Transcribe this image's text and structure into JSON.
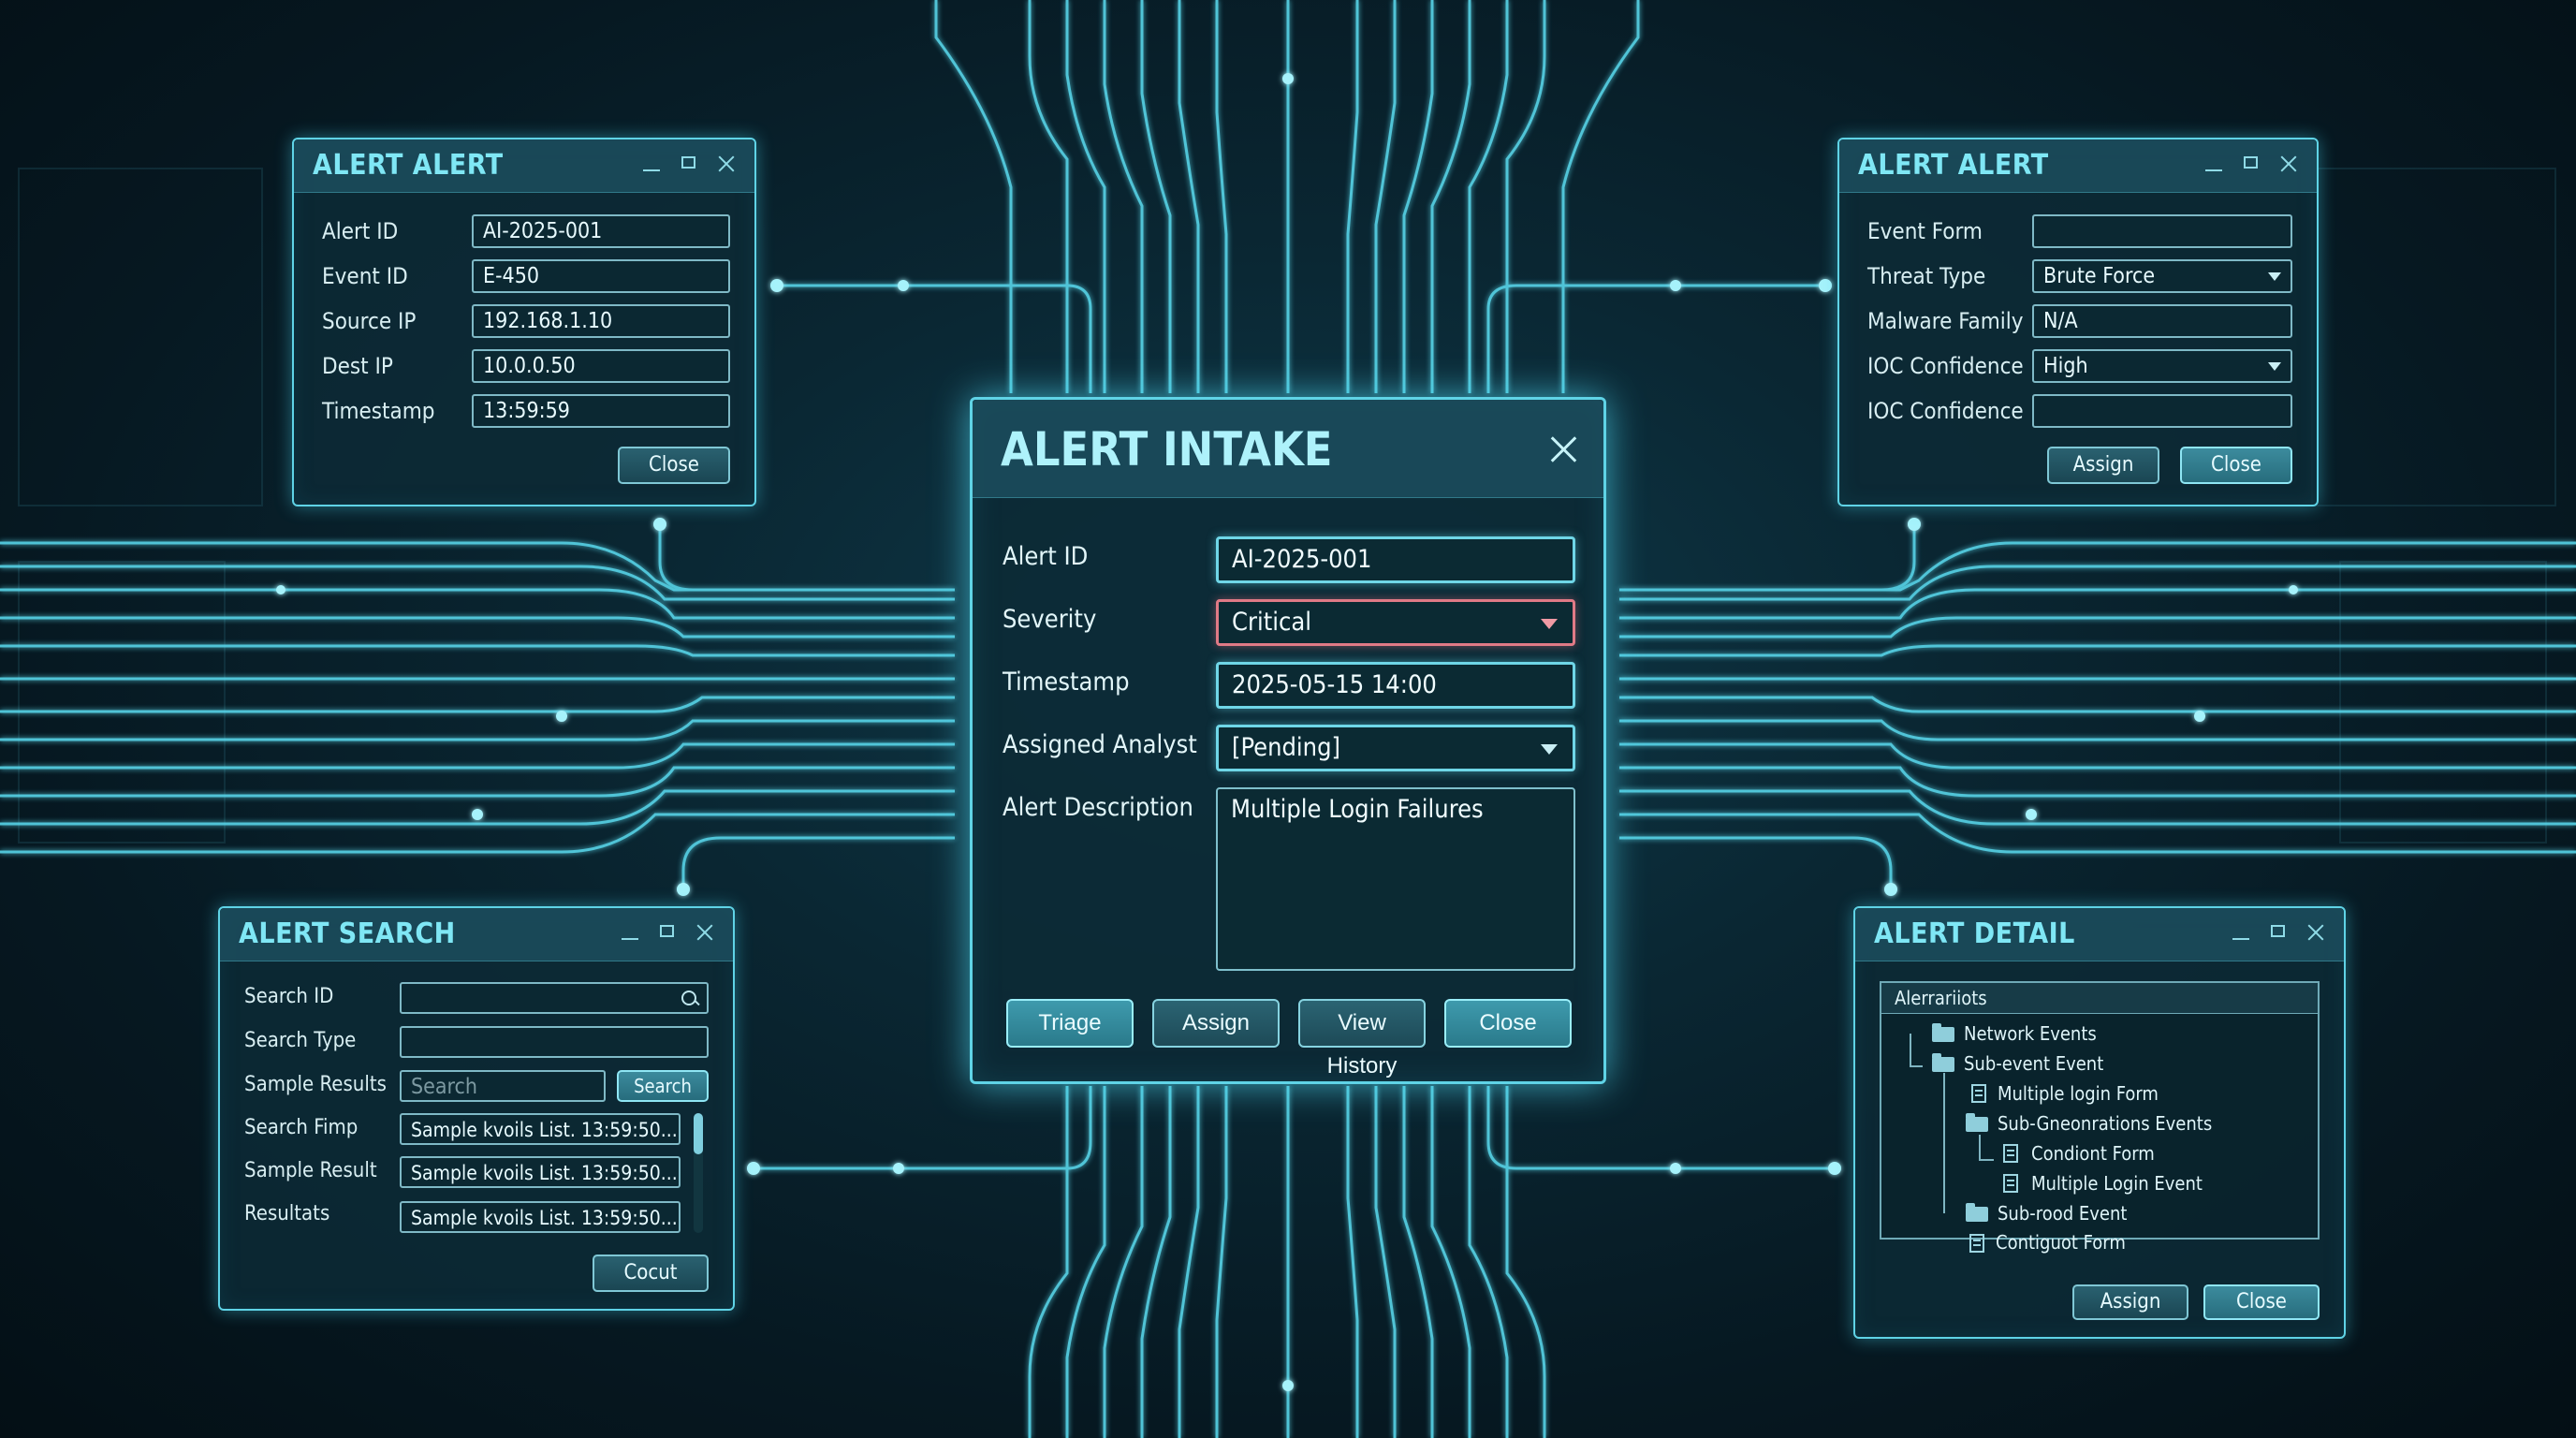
{
  "colors": {
    "accent": "#5fd3e6",
    "alert_red": "#e07a86",
    "background": "#061821"
  },
  "alert_alert_left": {
    "title": "ALERT ALERT",
    "fields": [
      {
        "label": "Alert ID",
        "value": "AI-2025-001"
      },
      {
        "label": "Event ID",
        "value": "E-450"
      },
      {
        "label": "Source IP",
        "value": "192.168.1.10"
      },
      {
        "label": "Dest IP",
        "value": "10.0.0.50"
      },
      {
        "label": "Timestamp",
        "value": "13:59:59"
      }
    ],
    "close_label": "Close"
  },
  "alert_alert_right": {
    "title": "ALERT ALERT",
    "fields": [
      {
        "label": "Event Form",
        "value": ""
      },
      {
        "label": "Threat Type",
        "value": "Brute Force"
      },
      {
        "label": "Malware Family",
        "value": "N/A"
      },
      {
        "label": "IOC Confidence",
        "value": "High"
      },
      {
        "label": "IOC Confidence",
        "value": ""
      }
    ],
    "assign_label": "Assign",
    "close_label": "Close"
  },
  "alert_intake": {
    "title": "ALERT INTAKE",
    "fields": [
      {
        "label": "Alert ID",
        "value": "AI-2025-001"
      },
      {
        "label": "Severity",
        "value": "Critical"
      },
      {
        "label": "Timestamp",
        "value": "2025-05-15 14:00"
      },
      {
        "label": "Assigned Analyst",
        "value": "[Pending]"
      },
      {
        "label": "Alert Description",
        "value": "Multiple Login Failures"
      }
    ],
    "buttons": {
      "triage": "Triage",
      "assign": "Assign",
      "view_history": "View History",
      "close": "Close"
    }
  },
  "alert_search": {
    "title": "ALERT SEARCH",
    "rows": [
      {
        "label": "Search ID",
        "value": ""
      },
      {
        "label": "Search Type",
        "value": ""
      },
      {
        "label": "Sample Results",
        "placeholder": "Search",
        "button": "Search"
      },
      {
        "label": "Search Fimp",
        "value": "Sample kvoils List. 13:59:50..."
      },
      {
        "label": "Sample Result",
        "value": "Sample kvoils List. 13:59:50..."
      },
      {
        "label": "Resultats",
        "value": "Sample kvoils List. 13:59:50..."
      }
    ],
    "cocut_label": "Cocut"
  },
  "alert_detail": {
    "title": "ALERT DETAIL",
    "tree_header": "Alerrariiots",
    "tree": [
      {
        "label": "Network Events",
        "icon": "folder"
      },
      {
        "label": "Sub-event Event",
        "icon": "folder"
      },
      {
        "label": "Multiple login Form",
        "icon": "doc"
      },
      {
        "label": "Sub-Gneonrations Events",
        "icon": "folder-open"
      },
      {
        "label": "Condiont Form",
        "icon": "doc"
      },
      {
        "label": "Multiple Login Event",
        "icon": "doc"
      },
      {
        "label": "Sub-rood Event",
        "icon": "folder"
      },
      {
        "label": "Contiguot Form",
        "icon": "doc"
      }
    ],
    "assign_label": "Assign",
    "close_label": "Close"
  }
}
